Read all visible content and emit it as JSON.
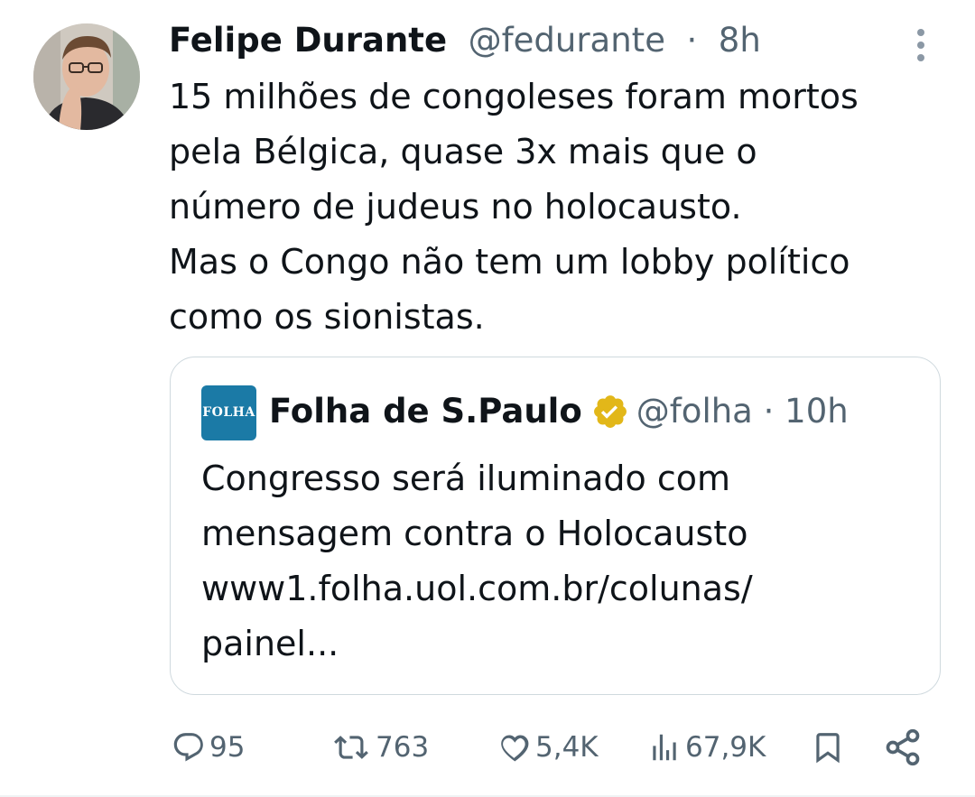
{
  "tweet": {
    "author_name": "Felipe Durante",
    "author_handle": "@fedurante",
    "separator": "·",
    "time": "8h",
    "text_lines": [
      "15 milhões de congoleses foram mortos",
      "pela Bélgica, quase 3x mais que o",
      "número de judeus no holocausto.",
      "Mas o Congo não tem um lobby político",
      "como os sionistas."
    ]
  },
  "quote": {
    "logo_text": "FOLHA",
    "author_name": "Folha de S.Paulo",
    "author_handle": "@folha",
    "separator": "·",
    "time": "10h",
    "text_lines": [
      "Congresso será iluminado com",
      "mensagem contra o Holocausto",
      "www1.folha.uol.com.br/colunas/",
      "painel..."
    ]
  },
  "actions": {
    "replies": "95",
    "reposts": "763",
    "likes": "5,4K",
    "views": "67,9K"
  },
  "icons": {
    "more": "more-vertical-icon",
    "verified": "verified-badge-icon",
    "reply": "reply-icon",
    "repost": "repost-icon",
    "like": "heart-icon",
    "views": "views-chart-icon",
    "bookmark": "bookmark-icon",
    "share": "share-icon"
  },
  "colors": {
    "text": "#0f1419",
    "secondary": "#536471",
    "border": "#cfd9de",
    "verified_gold": "#e2b719",
    "folha_logo": "#1b7aa6"
  }
}
